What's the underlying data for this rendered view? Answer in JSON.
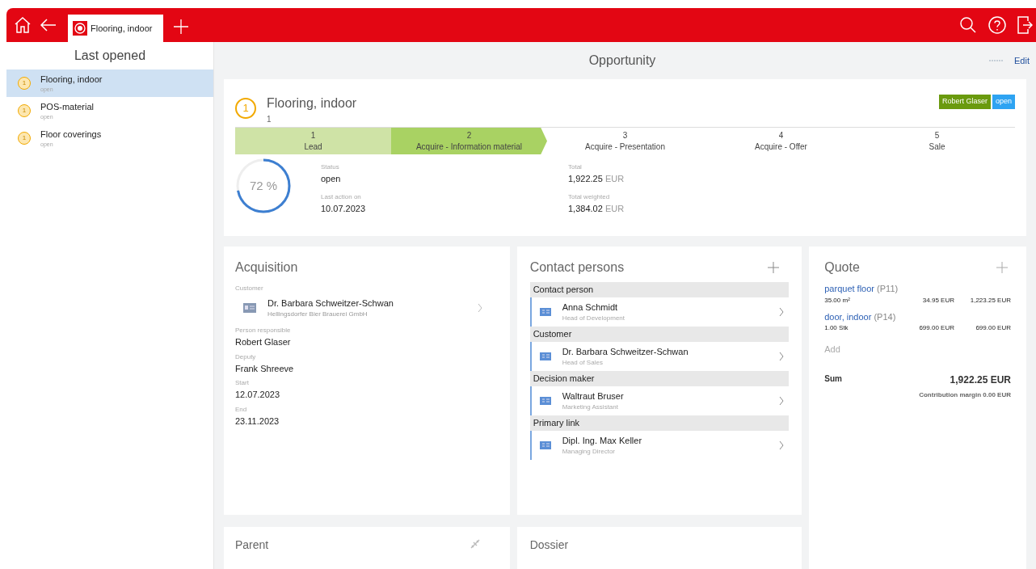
{
  "tab": {
    "label": "Flooring, indoor",
    "selected": true
  },
  "sidebar": {
    "title": "Last opened",
    "items": [
      {
        "name": "Flooring, indoor",
        "status": "open",
        "number": "1",
        "selected": true
      },
      {
        "name": "POS-material",
        "status": "open",
        "number": "1",
        "selected": false
      },
      {
        "name": "Floor coverings",
        "status": "open",
        "number": "1",
        "selected": false
      }
    ]
  },
  "header": {
    "title": "Opportunity",
    "edit": "Edit"
  },
  "opportunity": {
    "number": "1",
    "title": "Flooring, indoor",
    "subtitle": "1",
    "tags": [
      {
        "label": "Robert Glaser",
        "color": "#6a9a0e"
      },
      {
        "label": "open",
        "color": "#2ea3f2"
      }
    ],
    "stages": [
      {
        "number": "1",
        "label": "Lead",
        "done": true,
        "current": false
      },
      {
        "number": "2",
        "label": "Acquire - Information material",
        "done": false,
        "current": true
      },
      {
        "number": "3",
        "label": "Acquire - Presentation",
        "done": false,
        "current": false
      },
      {
        "number": "4",
        "label": "Acquire - Offer",
        "done": false,
        "current": false
      },
      {
        "number": "5",
        "label": "Sale",
        "done": false,
        "current": false
      }
    ],
    "progress": {
      "reading": "72 %"
    },
    "fields_left": [
      {
        "label": "Status",
        "value": "open"
      },
      {
        "label": "Last action on",
        "value": "10.07.2023"
      }
    ],
    "fields_right": [
      {
        "label": "Total",
        "amount": "1,922.25",
        "unit": "EUR"
      },
      {
        "label": "Total weighted",
        "amount": "1,384.02",
        "unit": "EUR"
      }
    ]
  },
  "acquisition": {
    "title": "Acquisition",
    "customer_label": "Customer",
    "customer": {
      "name": "Dr. Barbara Schweitzer-Schwan",
      "company": "Hellingsdorfer Bier Brauerei GmbH"
    },
    "fields": [
      {
        "label": "Person responsible",
        "value": "Robert Glaser"
      },
      {
        "label": "Deputy",
        "value": "Frank Shreeve"
      },
      {
        "label": "Start",
        "value": "12.07.2023"
      },
      {
        "label": "End",
        "value": "23.11.2023"
      }
    ]
  },
  "contacts": {
    "title": "Contact persons",
    "groups": [
      {
        "role": "Contact person",
        "name": "Anna Schmidt",
        "position": "Head of Development"
      },
      {
        "role": "Customer",
        "name": "Dr. Barbara Schweitzer-Schwan",
        "position": "Head of Sales"
      },
      {
        "role": "Decision maker",
        "name": "Waltraut Bruser",
        "position": "Marketing Assistant"
      },
      {
        "role": "Primary link",
        "name": "Dipl. Ing. Max Keller",
        "position": "Managing Director"
      }
    ]
  },
  "quote": {
    "title": "Quote",
    "items": [
      {
        "product": "parquet floor",
        "code": "(P11)",
        "quantity": "35.00 m²",
        "price": "34.95 EUR",
        "total": "1,223.25 EUR"
      },
      {
        "product": "door, indoor",
        "code": "(P14)",
        "quantity": "1.00 Stk",
        "price": "699.00 EUR",
        "total": "699.00 EUR"
      }
    ],
    "add": "Add",
    "sum_label": "Sum",
    "sum": "1,922.25 EUR",
    "margin": "Contribution margin 0.00 EUR"
  },
  "bottom_cards": [
    {
      "title": "Parent",
      "kind": "link"
    },
    {
      "title": "Dossier",
      "kind": "plain"
    }
  ]
}
